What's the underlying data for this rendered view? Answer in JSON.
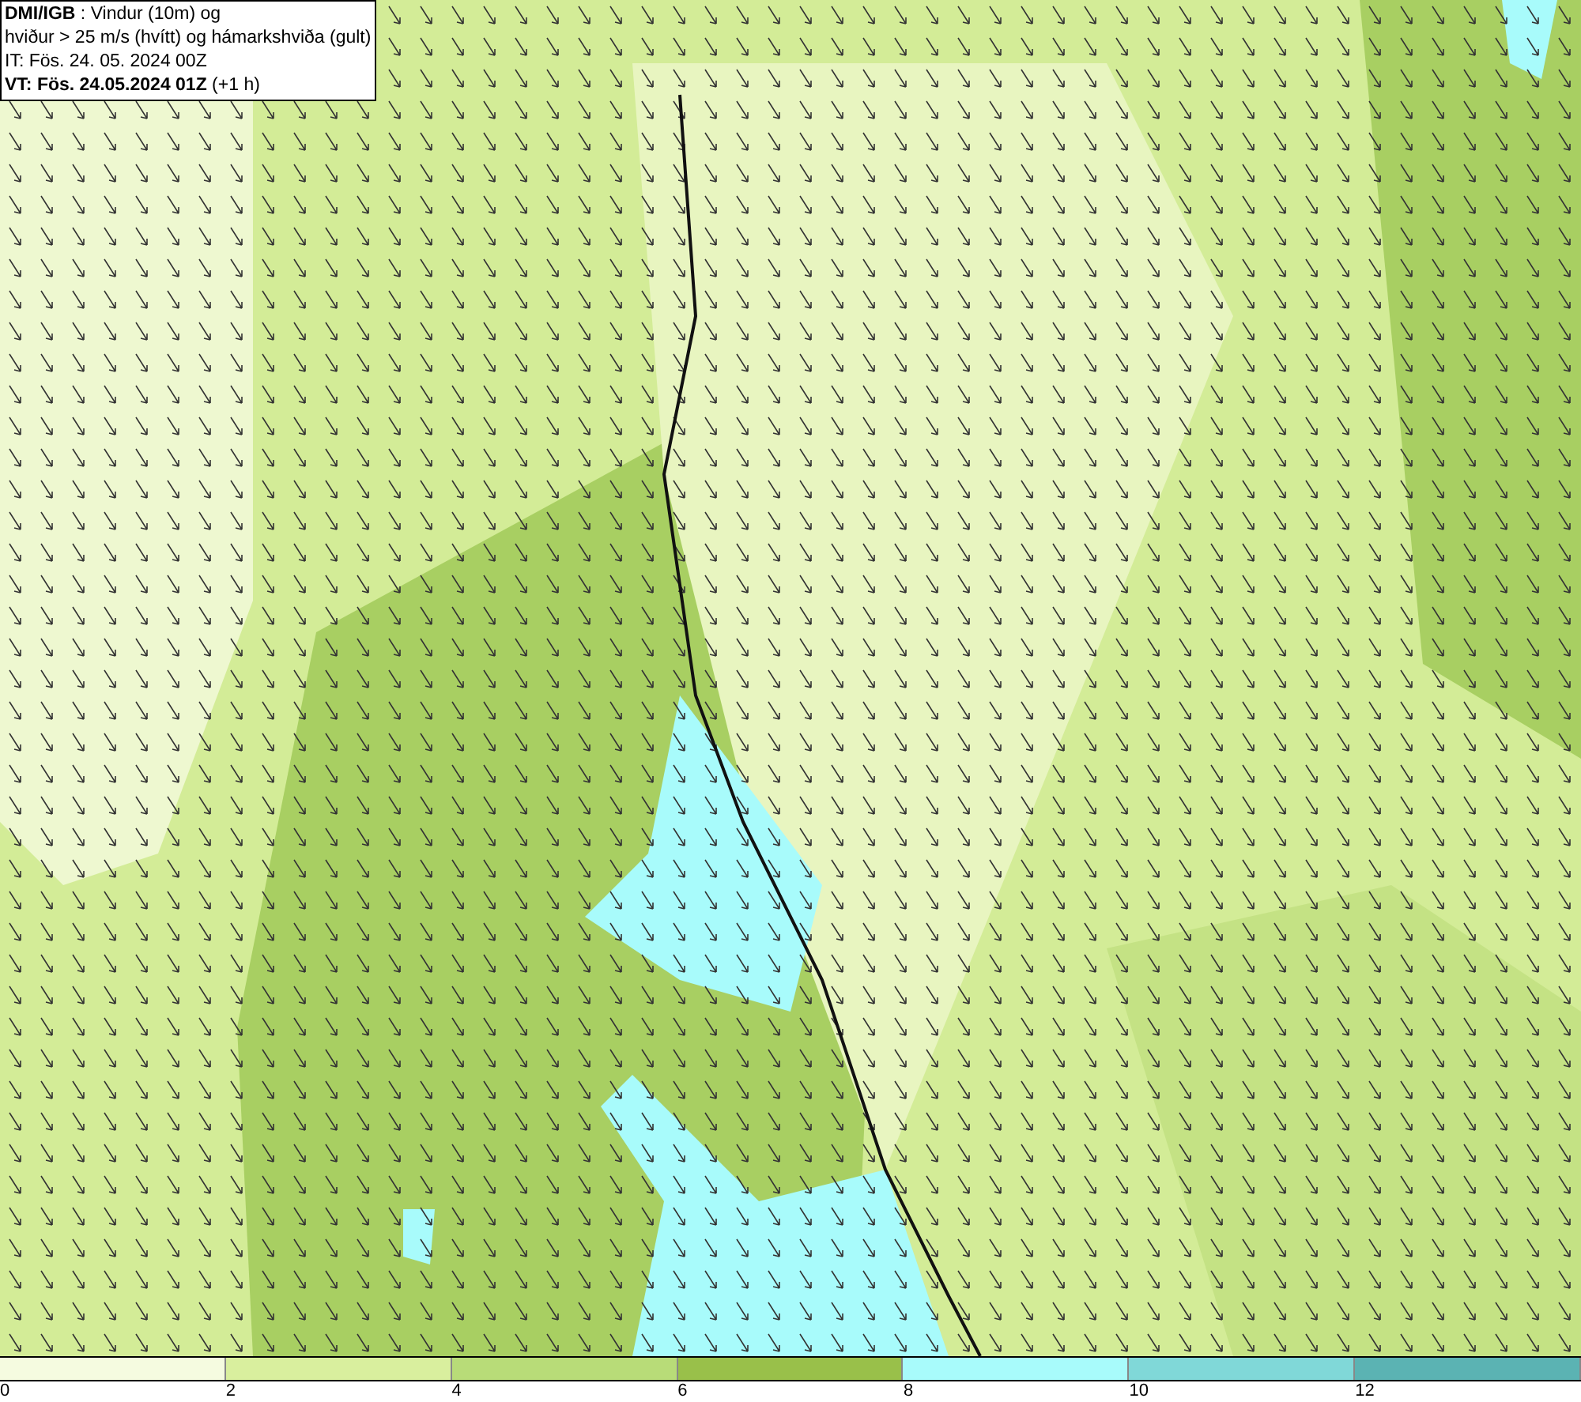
{
  "header": {
    "lines": [
      "**DMI/IGB** : Vindur (10m) og",
      "hviður > 25 m/s (hvítt) og hámarkshviða (gult)",
      "IT: Fös. 24. 05. 2024 00Z",
      "**VT: Fös. 24.05.2024 01Z** (+1 h)"
    ]
  },
  "legend": [
    {
      "label": "0",
      "color": "#f5fbe0"
    },
    {
      "label": "2",
      "color": "#d9ef9e"
    },
    {
      "label": "4",
      "color": "#b8dc78"
    },
    {
      "label": "6",
      "color": "#99c04a"
    },
    {
      "label": "8",
      "color": "#a8fbfb"
    },
    {
      "label": "10",
      "color": "#80d8d8"
    },
    {
      "label": "12",
      "color": "#5bb3b3"
    }
  ]
}
